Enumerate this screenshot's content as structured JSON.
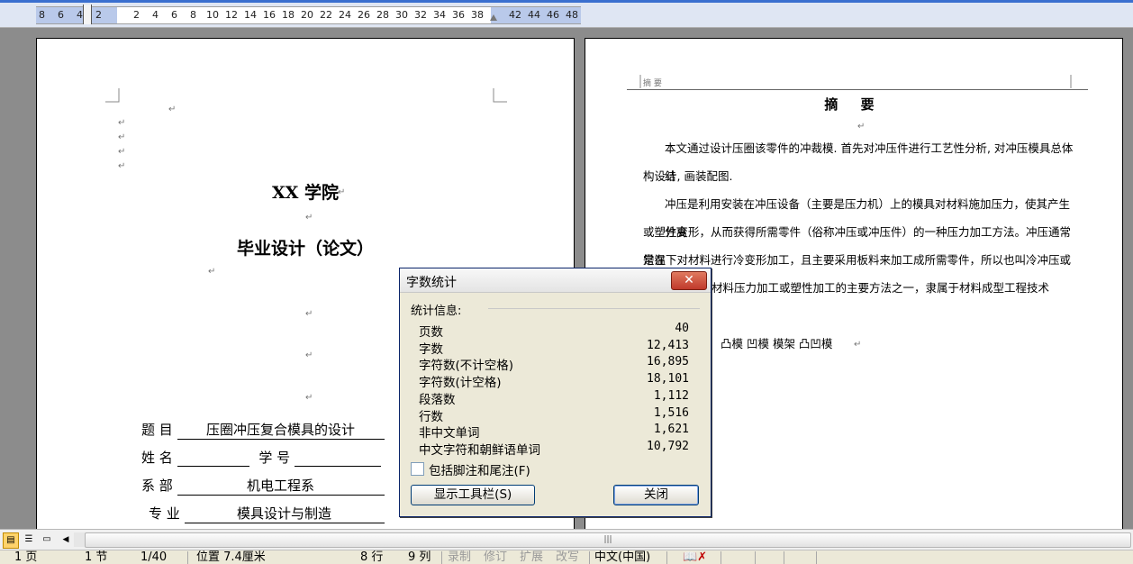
{
  "ruler": {
    "numbers": [
      "8",
      "6",
      "4",
      "2",
      "2",
      "4",
      "6",
      "8",
      "10",
      "12",
      "14",
      "16",
      "18",
      "20",
      "22",
      "24",
      "26",
      "28",
      "30",
      "32",
      "34",
      "36",
      "38",
      "42",
      "44",
      "46",
      "48"
    ]
  },
  "page1": {
    "school": "XX 学院",
    "thesis_title": "毕业设计（论文）",
    "fields": {
      "topic_label": "题    目",
      "topic_value": "压圈冲压复合模具的设计",
      "name_label": "姓    名",
      "student_id_label": "学    号",
      "dept_label": "系    部",
      "dept_value": "机电工程系",
      "major_label": "专    业",
      "major_value": "模具设计与制造"
    }
  },
  "page2": {
    "header_text": "摘 要",
    "abstract_title": "摘  要",
    "para1_line1": "本文通过设计压圈该零件的冲裁模. 首先对冲压件进行工艺性分析, 对冲压模具总体结",
    "para1_line2": "构设计, 画装配图.",
    "para2_line1": "冲压是利用安装在冲压设备（主要是压力机）上的模具对材料施加压力，使其产生分离",
    "para2_line2": "或塑性变形，从而获得所需零件（俗称冲压或冲压件）的一种压力加工方法。冲压通常是在",
    "para2_line3": "常温下对材料进行冷变形加工，且主要采用板料来加工成所需零件，所以也叫冷冲压或板料",
    "para2_line4": "材料压力加工或塑性加工的主要方法之一，隶属于材料成型工程技术",
    "keywords": "凸模 凹模 模架 凸凹模"
  },
  "dialog": {
    "title": "字数统计",
    "close_glyph": "✕",
    "section_label": "统计信息:",
    "stats": [
      {
        "label": "页数",
        "value": "40"
      },
      {
        "label": "字数",
        "value": "12,413"
      },
      {
        "label": "字符数(不计空格)",
        "value": "16,895"
      },
      {
        "label": "字符数(计空格)",
        "value": "18,101"
      },
      {
        "label": "段落数",
        "value": "1,112"
      },
      {
        "label": "行数",
        "value": "1,516"
      },
      {
        "label": "非中文单词",
        "value": "1,621"
      },
      {
        "label": "中文字符和朝鲜语单词",
        "value": "10,792"
      }
    ],
    "checkbox_label": "包括脚注和尾注(F)",
    "show_toolbar_button": "显示工具栏(S)",
    "close_button": "关闭"
  },
  "statusbar": {
    "page": "1 页",
    "section": "1 节",
    "page_of": "1/40",
    "position": "位置 7.4厘米",
    "line": "8 行",
    "column": "9 列",
    "rec": "录制",
    "trk": "修订",
    "ext": "扩展",
    "ovr": "改写",
    "language": "中文(中国)"
  },
  "colors": {
    "ruler_margin": "#b9c9ea",
    "dialog_bg": "#ece9d8",
    "close_red": "#c0392b"
  }
}
